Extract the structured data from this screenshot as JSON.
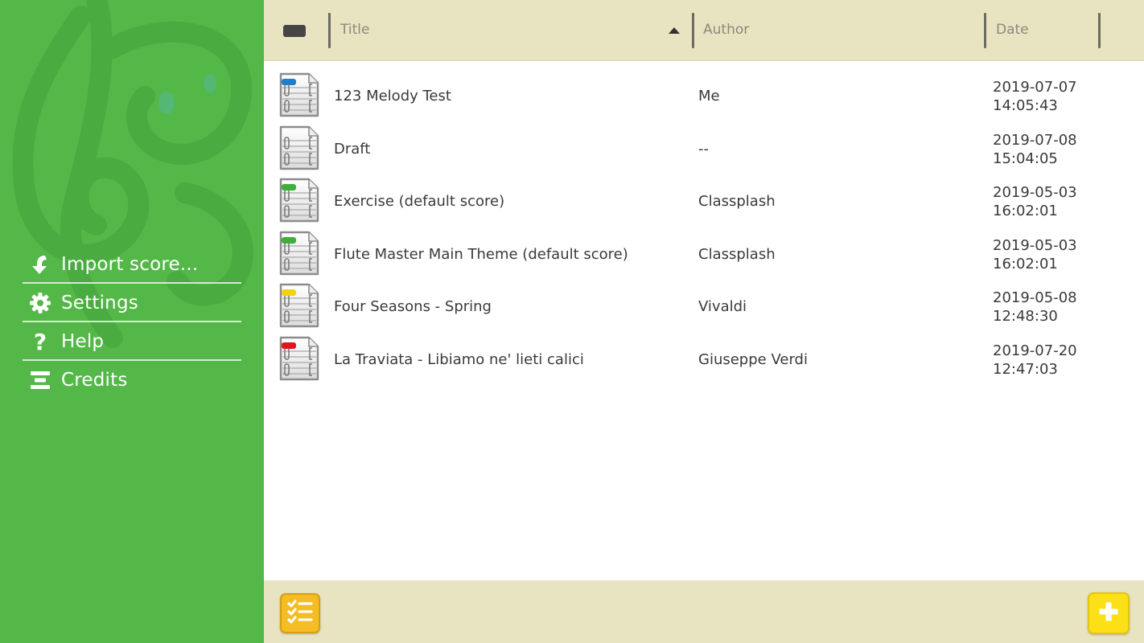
{
  "sidebar": {
    "items": [
      {
        "label": "Import score...",
        "icon": "import-arrow-icon"
      },
      {
        "label": "Settings",
        "icon": "gear-icon"
      },
      {
        "label": "Help",
        "icon": "question-icon"
      },
      {
        "label": "Credits",
        "icon": "credits-icon"
      }
    ]
  },
  "header": {
    "columns": [
      {
        "label": "Title",
        "sorted": "ascending"
      },
      {
        "label": "Author"
      },
      {
        "label": "Date"
      }
    ]
  },
  "scores": [
    {
      "title": "123 Melody Test",
      "author": "Me",
      "date": "2019-07-07",
      "time": "14:05:43",
      "tag_color": "#1e7fcf"
    },
    {
      "title": "Draft",
      "author": "--",
      "date": "2019-07-08",
      "time": "15:04:05",
      "tag_color": null
    },
    {
      "title": "Exercise (default score)",
      "author": "Classplash",
      "date": "2019-05-03",
      "time": "16:02:01",
      "tag_color": "#3fae3a"
    },
    {
      "title": "Flute Master Main Theme (default score)",
      "author": "Classplash",
      "date": "2019-05-03",
      "time": "16:02:01",
      "tag_color": "#3fae3a"
    },
    {
      "title": "Four Seasons - Spring",
      "author": "Vivaldi",
      "date": "2019-05-08",
      "time": "12:48:30",
      "tag_color": "#f2d20c"
    },
    {
      "title": "La Traviata - Libiamo ne' lieti calici",
      "author": "Giuseppe Verdi",
      "date": "2019-07-20",
      "time": "12:47:03",
      "tag_color": "#e0141c"
    }
  ],
  "footer": {
    "select_button_icon": "checklist-icon",
    "add_button_icon": "plus-icon"
  },
  "colors": {
    "sidebar_green": "#53b848",
    "header_beige": "#e8e4c1",
    "select_button": "#f3bd23",
    "add_button": "#fbe018"
  }
}
